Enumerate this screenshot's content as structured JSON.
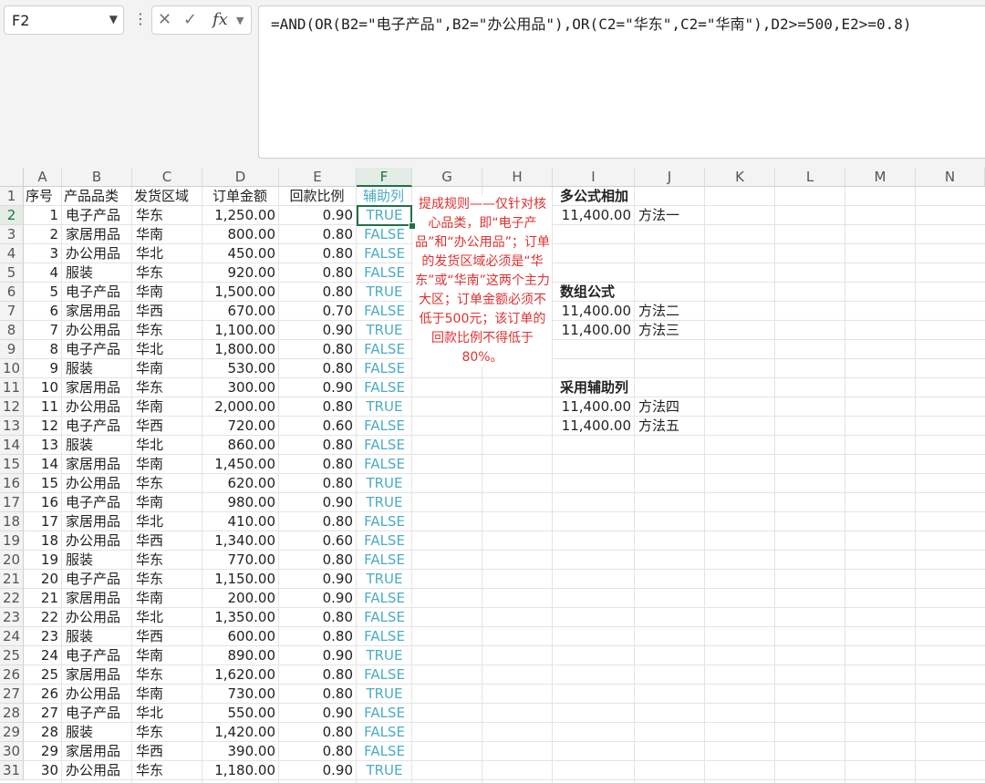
{
  "name_box": "F2",
  "formula": "=AND(OR(B2=\"电子产品\",B2=\"办公用品\"),OR(C2=\"华东\",C2=\"华南\"),D2>=500,E2>=0.8)",
  "icons": {
    "more": "more-vertical-icon",
    "cancel": "cancel-icon",
    "confirm": "check-icon",
    "fx": "function-icon"
  },
  "columns": [
    "A",
    "B",
    "C",
    "D",
    "E",
    "F",
    "G",
    "H",
    "I",
    "J",
    "K",
    "L",
    "M",
    "N"
  ],
  "header_row": [
    "序号",
    "产品品类",
    "发货区域",
    "订单金额",
    "回款比例",
    "辅助列"
  ],
  "rows": [
    [
      "1",
      "电子产品",
      "华东",
      "1,250.00",
      "0.90",
      "TRUE"
    ],
    [
      "2",
      "家居用品",
      "华南",
      "800.00",
      "0.80",
      "FALSE"
    ],
    [
      "3",
      "办公用品",
      "华北",
      "450.00",
      "0.80",
      "FALSE"
    ],
    [
      "4",
      "服装",
      "华东",
      "920.00",
      "0.80",
      "FALSE"
    ],
    [
      "5",
      "电子产品",
      "华南",
      "1,500.00",
      "0.80",
      "TRUE"
    ],
    [
      "6",
      "家居用品",
      "华西",
      "670.00",
      "0.70",
      "FALSE"
    ],
    [
      "7",
      "办公用品",
      "华东",
      "1,100.00",
      "0.90",
      "TRUE"
    ],
    [
      "8",
      "电子产品",
      "华北",
      "1,800.00",
      "0.80",
      "FALSE"
    ],
    [
      "9",
      "服装",
      "华南",
      "530.00",
      "0.80",
      "FALSE"
    ],
    [
      "10",
      "家居用品",
      "华东",
      "300.00",
      "0.90",
      "FALSE"
    ],
    [
      "11",
      "办公用品",
      "华南",
      "2,000.00",
      "0.80",
      "TRUE"
    ],
    [
      "12",
      "电子产品",
      "华西",
      "720.00",
      "0.60",
      "FALSE"
    ],
    [
      "13",
      "服装",
      "华北",
      "860.00",
      "0.80",
      "FALSE"
    ],
    [
      "14",
      "家居用品",
      "华南",
      "1,450.00",
      "0.80",
      "FALSE"
    ],
    [
      "15",
      "办公用品",
      "华东",
      "620.00",
      "0.80",
      "TRUE"
    ],
    [
      "16",
      "电子产品",
      "华南",
      "980.00",
      "0.90",
      "TRUE"
    ],
    [
      "17",
      "家居用品",
      "华北",
      "410.00",
      "0.80",
      "FALSE"
    ],
    [
      "18",
      "办公用品",
      "华西",
      "1,340.00",
      "0.60",
      "FALSE"
    ],
    [
      "19",
      "服装",
      "华东",
      "770.00",
      "0.80",
      "FALSE"
    ],
    [
      "20",
      "电子产品",
      "华东",
      "1,150.00",
      "0.90",
      "TRUE"
    ],
    [
      "21",
      "家居用品",
      "华南",
      "200.00",
      "0.90",
      "FALSE"
    ],
    [
      "22",
      "办公用品",
      "华北",
      "1,350.00",
      "0.80",
      "FALSE"
    ],
    [
      "23",
      "服装",
      "华西",
      "600.00",
      "0.80",
      "FALSE"
    ],
    [
      "24",
      "电子产品",
      "华南",
      "890.00",
      "0.90",
      "TRUE"
    ],
    [
      "25",
      "家居用品",
      "华东",
      "1,620.00",
      "0.80",
      "FALSE"
    ],
    [
      "26",
      "办公用品",
      "华南",
      "730.00",
      "0.80",
      "TRUE"
    ],
    [
      "27",
      "电子产品",
      "华北",
      "550.00",
      "0.90",
      "FALSE"
    ],
    [
      "28",
      "服装",
      "华东",
      "1,420.00",
      "0.80",
      "FALSE"
    ],
    [
      "29",
      "家居用品",
      "华西",
      "390.00",
      "0.80",
      "FALSE"
    ],
    [
      "30",
      "办公用品",
      "华东",
      "1,180.00",
      "0.90",
      "TRUE"
    ]
  ],
  "note": "提成规则——仅针对核心品类，即“电子产品”和“办公用品”；订单的发货区域必须是“华东”或“华南”这两个主力大区；订单金额必须不低于500元；该订单的回款比例不得低于80%。",
  "results": {
    "section1_title": "多公式相加",
    "m1_value": "11,400.00",
    "m1_label": "方法一",
    "section2_title": "数组公式",
    "m2_value": "11,400.00",
    "m2_label": "方法二",
    "m3_value": "11,400.00",
    "m3_label": "方法三",
    "section3_title": "采用辅助列",
    "m4_value": "11,400.00",
    "m4_label": "方法四",
    "m5_value": "11,400.00",
    "m5_label": "方法五"
  },
  "colors": {
    "true_false": "#4bacc6",
    "note": "#e03030",
    "selection": "#1e7145"
  }
}
